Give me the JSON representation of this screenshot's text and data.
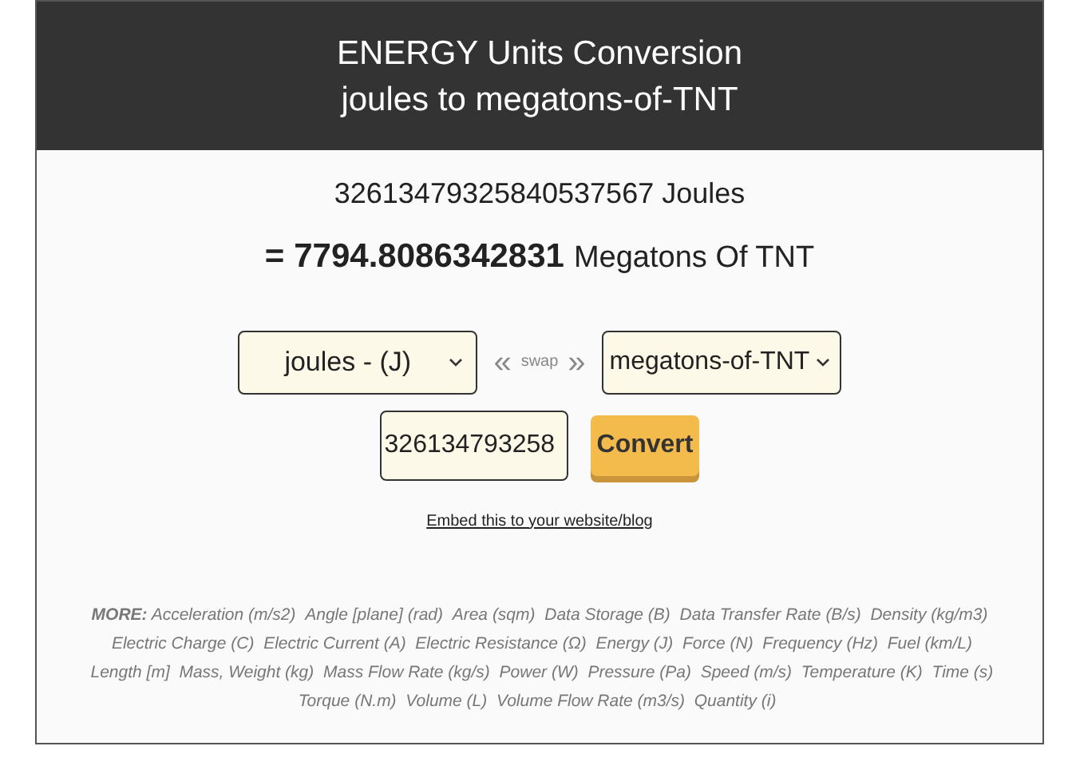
{
  "header": {
    "title_line_1": "ENERGY Units Conversion",
    "title_line_2": "joules to megatons-of-TNT"
  },
  "result": {
    "input_text": "32613479325840537567 Joules",
    "equals": "=",
    "value": "7794.8086342831",
    "unit": "Megatons Of TNT"
  },
  "converter": {
    "from_unit": "joules - (J)",
    "swap_left": "«",
    "swap_label": "swap",
    "swap_right": "»",
    "to_unit": "megatons-of-TNT",
    "amount": "326134793258",
    "convert_button": "Convert",
    "embed_link": "Embed this to your website/blog"
  },
  "more": {
    "label": "MORE:",
    "links": [
      "Acceleration (m/s2)",
      "Angle [plane] (rad)",
      "Area (sqm)",
      "Data Storage (B)",
      "Data Transfer Rate (B/s)",
      "Density (kg/m3)",
      "Electric Charge (C)",
      "Electric Current (A)",
      "Electric Resistance (Ω)",
      "Energy (J)",
      "Force (N)",
      "Frequency (Hz)",
      "Fuel (km/L)",
      "Length [m]",
      "Mass, Weight (kg)",
      "Mass Flow Rate (kg/s)",
      "Power (W)",
      "Pressure (Pa)",
      "Speed (m/s)",
      "Temperature (K)",
      "Time (s)",
      "Torque (N.m)",
      "Volume (L)",
      "Volume Flow Rate (m3/s)",
      "Quantity (i)"
    ]
  }
}
